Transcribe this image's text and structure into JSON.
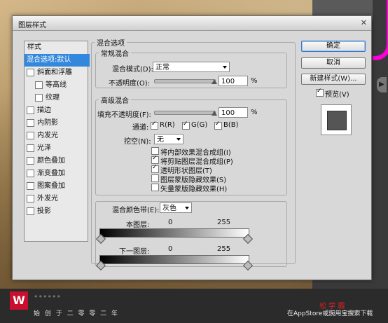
{
  "dialog_title": "图层样式",
  "left_list": {
    "header": "样式",
    "items": [
      {
        "label": "混合选项:默认",
        "checkbox": false,
        "highlighted": true,
        "indent": 0
      },
      {
        "label": "斜面和浮雕",
        "checkbox": true,
        "highlighted": false,
        "indent": 0
      },
      {
        "label": "等高线",
        "checkbox": true,
        "highlighted": false,
        "indent": 1
      },
      {
        "label": "纹理",
        "checkbox": true,
        "highlighted": false,
        "indent": 1
      },
      {
        "label": "描边",
        "checkbox": true,
        "highlighted": false,
        "indent": 0
      },
      {
        "label": "内阴影",
        "checkbox": true,
        "highlighted": false,
        "indent": 0
      },
      {
        "label": "内发光",
        "checkbox": true,
        "highlighted": false,
        "indent": 0
      },
      {
        "label": "光泽",
        "checkbox": true,
        "highlighted": false,
        "indent": 0
      },
      {
        "label": "颜色叠加",
        "checkbox": true,
        "highlighted": false,
        "indent": 0
      },
      {
        "label": "渐变叠加",
        "checkbox": true,
        "highlighted": false,
        "indent": 0
      },
      {
        "label": "图案叠加",
        "checkbox": true,
        "highlighted": false,
        "indent": 0
      },
      {
        "label": "外发光",
        "checkbox": true,
        "highlighted": false,
        "indent": 0
      },
      {
        "label": "投影",
        "checkbox": true,
        "highlighted": false,
        "indent": 0
      }
    ]
  },
  "blend_options": {
    "group_title": "混合选项",
    "general": {
      "title": "常规混合",
      "mode_label": "混合模式(D):",
      "mode_value": "正常",
      "opacity_label": "不透明度(O):",
      "opacity_value": "100",
      "opacity_unit": "%",
      "opacity_level": 1.0
    },
    "advanced": {
      "title": "高级混合",
      "fill_label": "填充不透明度(F):",
      "fill_value": "100",
      "fill_unit": "%",
      "fill_level": 1.0,
      "channels_label": "通道:",
      "channel_r": "R(R)",
      "channel_g": "G(G)",
      "channel_b": "B(B)",
      "knockout_label": "挖空(N):",
      "knockout_value": "无",
      "options": [
        {
          "label": "将内部效果混合成组(I)",
          "checked": false
        },
        {
          "label": "将剪贴图层混合成组(P)",
          "checked": true
        },
        {
          "label": "透明形状图层(T)",
          "checked": true
        },
        {
          "label": "图层蒙版隐藏效果(S)",
          "checked": false
        },
        {
          "label": "矢量蒙版隐藏效果(H)",
          "checked": false
        }
      ]
    },
    "blend_if": {
      "label": "混合颜色带(E):",
      "value": "灰色",
      "this_layer_label": "本图层:",
      "this_layer_min": "0",
      "this_layer_max": "255",
      "underlying_label": "下一图层:",
      "underlying_min": "0",
      "underlying_max": "255"
    }
  },
  "buttons": {
    "ok": "确定",
    "cancel": "取消",
    "new_style": "新建样式(W)...",
    "preview_label": "预览(V)"
  },
  "footer": {
    "logo": "W",
    "tagline": "始 创 于 二 零 零 二 年",
    "faint_text": "••••••",
    "site_name": "松 学 霸",
    "store_text": "在AppStore或豌用宝搜索下载"
  },
  "colors": {
    "highlight": "#3388dd",
    "logo_red": "#c8102e",
    "accent_magenta": "#ff00d8"
  }
}
